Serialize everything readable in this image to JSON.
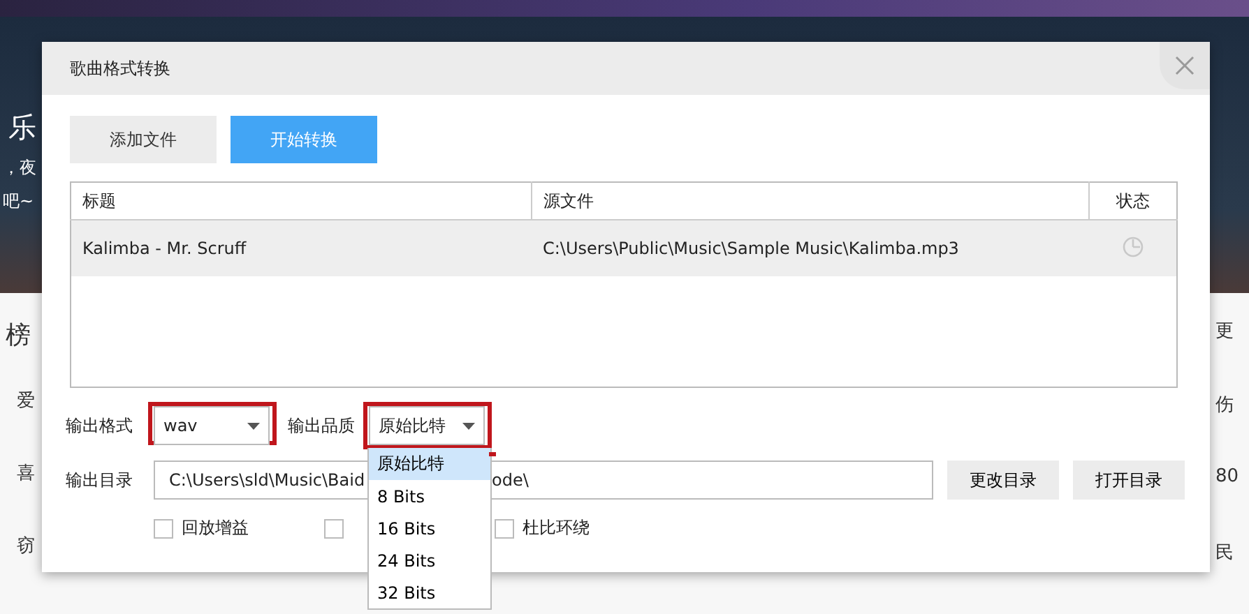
{
  "background": {
    "banner_texts": [
      "乐",
      "，夜",
      "吧~"
    ],
    "heading": "榜",
    "left_rows": [
      "爱",
      "喜",
      "窃"
    ],
    "right_rows": [
      "更",
      "伤",
      "80",
      "民"
    ]
  },
  "dialog": {
    "title": "歌曲格式转换",
    "buttons": [
      {
        "label": "添加文件",
        "primary": false
      },
      {
        "label": "开始转换",
        "primary": true
      }
    ],
    "table": {
      "columns": [
        "标题",
        "源文件",
        "状态"
      ],
      "rows": [
        {
          "title": "Kalimba - Mr. Scruff",
          "source": "C:\\Users\\Public\\Music\\Sample Music\\Kalimba.mp3",
          "selected": true
        }
      ]
    },
    "format": {
      "label": "输出格式",
      "value": "wav",
      "highlighted": true
    },
    "quality": {
      "label": "输出品质",
      "value": "原始比特",
      "highlighted": true,
      "expanded": true,
      "options": [
        {
          "label": "原始比特",
          "selected": true
        },
        {
          "label": "8 Bits",
          "selected": false
        },
        {
          "label": "16 Bits",
          "selected": false
        },
        {
          "label": "24 Bits",
          "selected": false
        },
        {
          "label": "32 Bits",
          "selected": false
        }
      ]
    },
    "output_dir": {
      "label": "输出目录",
      "value_start": "C:\\Users\\sld\\Music\\Baid",
      "value_end": "ode\\"
    },
    "dir_buttons": [
      "更改目录",
      "打开目录"
    ],
    "options": [
      {
        "label": "回放增益",
        "checked": false
      },
      {
        "checked": false
      },
      {
        "label": "杜比环绕",
        "checked": false
      }
    ]
  }
}
